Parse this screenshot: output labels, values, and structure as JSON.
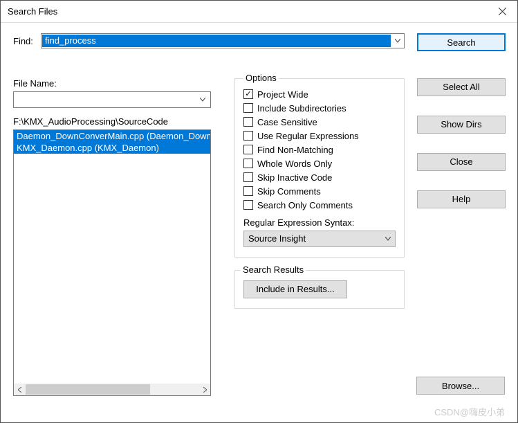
{
  "title": "Search Files",
  "find": {
    "label": "Find:",
    "value": "find_process"
  },
  "file_name": {
    "label": "File Name:",
    "value": ""
  },
  "path": "F:\\KMX_AudioProcessing\\SourceCode",
  "files": [
    "Daemon_DownConverMain.cpp (Daemon_DownConverMain)",
    "KMX_Daemon.cpp (KMX_Daemon)"
  ],
  "options": {
    "legend": "Options",
    "items": [
      {
        "label": "Project Wide",
        "checked": true
      },
      {
        "label": "Include Subdirectories",
        "checked": false
      },
      {
        "label": "Case Sensitive",
        "checked": false
      },
      {
        "label": "Use Regular Expressions",
        "checked": false
      },
      {
        "label": "Find Non-Matching",
        "checked": false
      },
      {
        "label": "Whole Words Only",
        "checked": false
      },
      {
        "label": "Skip Inactive Code",
        "checked": false
      },
      {
        "label": "Skip Comments",
        "checked": false
      },
      {
        "label": "Search Only Comments",
        "checked": false
      }
    ],
    "syntax_label": "Regular Expression Syntax:",
    "syntax_value": "Source Insight"
  },
  "results": {
    "legend": "Search Results",
    "include_btn": "Include in Results..."
  },
  "buttons": {
    "search": "Search",
    "select_all": "Select All",
    "show_dirs": "Show Dirs",
    "close": "Close",
    "help": "Help",
    "browse": "Browse..."
  },
  "watermark": "CSDN@嗨皮小弟"
}
